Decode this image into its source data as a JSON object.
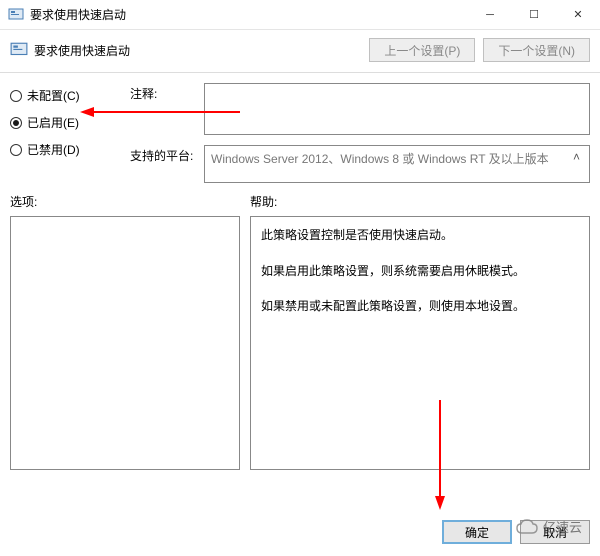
{
  "window": {
    "title": "要求使用快速启动"
  },
  "header": {
    "title": "要求使用快速启动",
    "prev_btn": "上一个设置(P)",
    "next_btn": "下一个设置(N)"
  },
  "radios": {
    "not_configured": "未配置(C)",
    "enabled": "已启用(E)",
    "disabled": "已禁用(D)",
    "selected": "enabled"
  },
  "form": {
    "comment_label": "注释:",
    "comment_value": "",
    "platform_label": "支持的平台:",
    "platform_value": "Windows Server 2012、Windows 8 或 Windows RT 及以上版本"
  },
  "panels": {
    "options_label": "选项:",
    "help_label": "帮助:",
    "help_paragraphs": [
      "此策略设置控制是否使用快速启动。",
      "如果启用此策略设置，则系统需要启用休眠模式。",
      "如果禁用或未配置此策略设置，则使用本地设置。"
    ]
  },
  "footer": {
    "ok": "确定",
    "cancel": "取消"
  },
  "watermark": {
    "text": "亿速云"
  },
  "colors": {
    "arrow": "#ff0000",
    "focus": "#6faedb"
  }
}
